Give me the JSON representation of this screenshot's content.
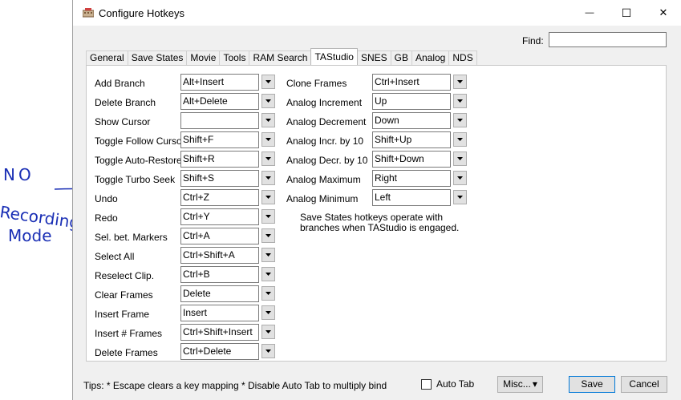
{
  "annotation": {
    "lines": [
      "NO",
      "Recording",
      "Mode"
    ],
    "color": "#1a2fb5"
  },
  "window": {
    "title": "Configure Hotkeys",
    "minimize_glyph": "—",
    "maximize_glyph": "☐",
    "close_glyph": "✕"
  },
  "find": {
    "label": "Find:",
    "value": ""
  },
  "tabs": [
    {
      "label": "General",
      "active": false
    },
    {
      "label": "Save States",
      "active": false
    },
    {
      "label": "Movie",
      "active": false
    },
    {
      "label": "Tools",
      "active": false
    },
    {
      "label": "RAM Search",
      "active": false
    },
    {
      "label": "TAStudio",
      "active": true
    },
    {
      "label": "SNES",
      "active": false
    },
    {
      "label": "GB",
      "active": false
    },
    {
      "label": "Analog",
      "active": false
    },
    {
      "label": "NDS",
      "active": false
    }
  ],
  "left_column": [
    {
      "label": "Add Branch",
      "binding": "Alt+Insert"
    },
    {
      "label": "Delete Branch",
      "binding": "Alt+Delete"
    },
    {
      "label": "Show Cursor",
      "binding": ""
    },
    {
      "label": "Toggle Follow Cursor",
      "binding": "Shift+F"
    },
    {
      "label": "Toggle Auto-Restore",
      "binding": "Shift+R"
    },
    {
      "label": "Toggle Turbo Seek",
      "binding": "Shift+S"
    },
    {
      "label": "Undo",
      "binding": "Ctrl+Z"
    },
    {
      "label": "Redo",
      "binding": "Ctrl+Y"
    },
    {
      "label": "Sel. bet. Markers",
      "binding": "Ctrl+A"
    },
    {
      "label": "Select All",
      "binding": "Ctrl+Shift+A"
    },
    {
      "label": "Reselect Clip.",
      "binding": "Ctrl+B"
    },
    {
      "label": "Clear Frames",
      "binding": "Delete"
    },
    {
      "label": "Insert Frame",
      "binding": "Insert"
    },
    {
      "label": "Insert # Frames",
      "binding": "Ctrl+Shift+Insert"
    },
    {
      "label": "Delete Frames",
      "binding": "Ctrl+Delete"
    }
  ],
  "right_column": [
    {
      "label": "Clone Frames",
      "binding": "Ctrl+Insert"
    },
    {
      "label": "Analog Increment",
      "binding": "Up"
    },
    {
      "label": "Analog Decrement",
      "binding": "Down"
    },
    {
      "label": "Analog Incr. by 10",
      "binding": "Shift+Up"
    },
    {
      "label": "Analog Decr. by 10",
      "binding": "Shift+Down"
    },
    {
      "label": "Analog Maximum",
      "binding": "Right"
    },
    {
      "label": "Analog Minimum",
      "binding": "Left"
    }
  ],
  "note": "Save States hotkeys operate with branches when TAStudio is engaged.",
  "footer": {
    "tips": "Tips:  * Escape clears a key mapping   * Disable Auto Tab to multiply bind",
    "auto_tab_label": "Auto Tab",
    "auto_tab_checked": false,
    "misc_label": "Misc...",
    "misc_arrow": "▾",
    "save_label": "Save",
    "cancel_label": "Cancel"
  }
}
